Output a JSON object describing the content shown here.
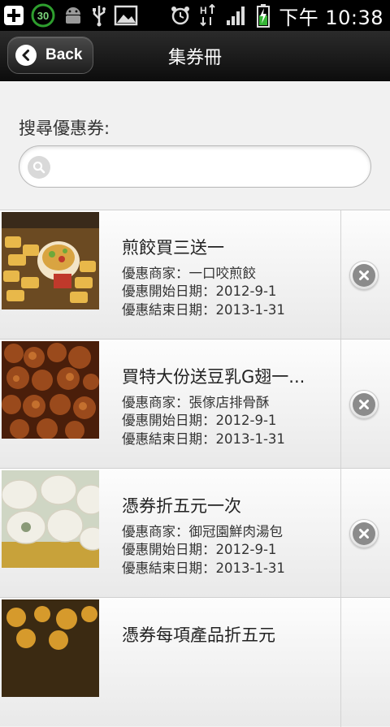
{
  "status_bar": {
    "left_icons": [
      "add-icon",
      "notification-30-icon",
      "android-icon",
      "usb-icon",
      "image-icon"
    ],
    "notification_count": "30",
    "right_icons": [
      "alarm-icon",
      "data-transfer-icon",
      "signal-icon",
      "battery-charging-icon"
    ],
    "time": "下午 10:38"
  },
  "header": {
    "back_label": "Back",
    "title": "集券冊"
  },
  "search": {
    "label": "搜尋優惠券:",
    "value": "",
    "placeholder": ""
  },
  "coupons": [
    {
      "title": "煎餃買三送一",
      "merchant": "優惠商家：一口咬煎餃",
      "start": "優惠開始日期：2012-9-1",
      "end": "優惠結束日期：2013-1-31",
      "image": "dumplings-photo"
    },
    {
      "title": "買特大份送豆乳G翅一...",
      "merchant": "優惠商家：張傢店排骨酥",
      "start": "優惠開始日期：2012-9-1",
      "end": "優惠結束日期：2013-1-31",
      "image": "fried-pork-photo"
    },
    {
      "title": "憑券折五元一次",
      "merchant": "優惠商家：御冠園鮮肉湯包",
      "start": "優惠開始日期：2012-9-1",
      "end": "優惠結束日期：2013-1-31",
      "image": "soup-dumplings-photo"
    },
    {
      "title": "憑券每項產品折五元",
      "merchant": "",
      "start": "",
      "end": "",
      "image": "fried-snack-photo"
    }
  ],
  "colors": {
    "status_bar": "#000000",
    "title_bar": "#1a1a1a",
    "notification_badge": "#2e9e2e",
    "battery_charge": "#35b535"
  }
}
